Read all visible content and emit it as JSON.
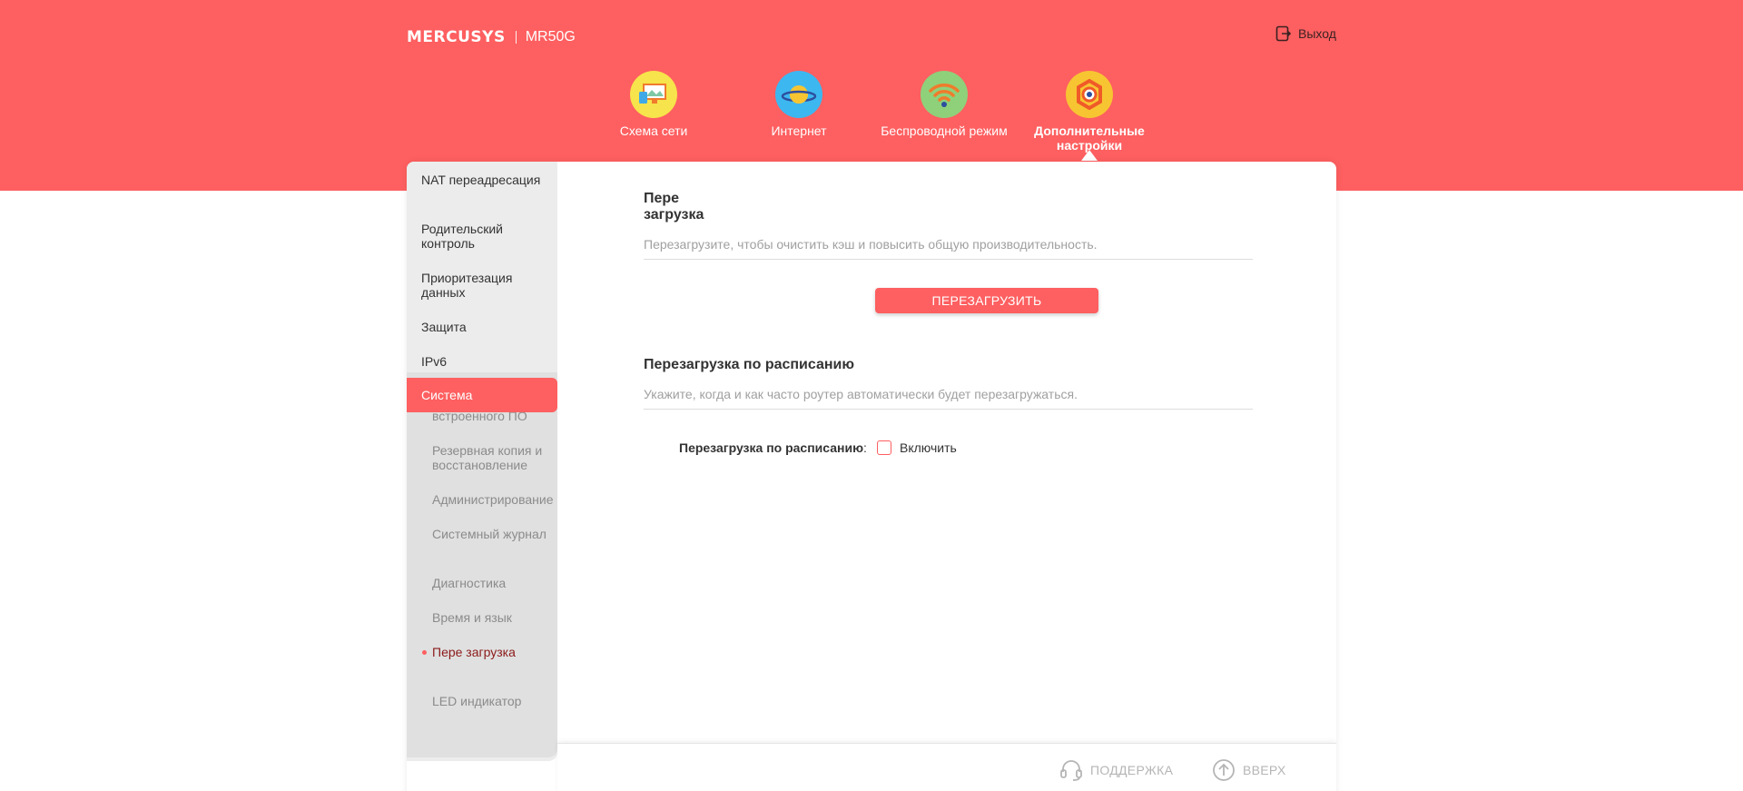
{
  "header": {
    "brand": "MERCUSYS",
    "model": "MR50G",
    "logout_label": "Выход"
  },
  "nav": {
    "items": [
      {
        "label": "Схема сети",
        "icon": "network-map-icon"
      },
      {
        "label": "Интернет",
        "icon": "internet-planet-icon"
      },
      {
        "label": "Беспроводной режим",
        "icon": "wifi-icon"
      },
      {
        "label": "Дополнительные настройки",
        "icon": "advanced-gear-icon"
      }
    ],
    "active_index": 3
  },
  "sidebar": {
    "items": [
      {
        "label": "NAT переадресация"
      },
      {
        "label": "Родительский контроль"
      },
      {
        "label": "Приоритезация данных"
      },
      {
        "label": "Защита"
      },
      {
        "label": "IPv6"
      },
      {
        "label": "Система"
      }
    ],
    "active_index": 5,
    "subitems": [
      {
        "label": "Обновление встроенного ПО"
      },
      {
        "label": "Резервная копия и восстановление"
      },
      {
        "label": "Администрирование"
      },
      {
        "label": "Системный журнал"
      },
      {
        "label": "Диагностика"
      },
      {
        "label": "Время и язык"
      },
      {
        "label": "Пере загрузка"
      },
      {
        "label": "LED индикатор"
      }
    ],
    "active_sub_index": 6
  },
  "reboot": {
    "title": "Пере загрузка",
    "description": "Перезагрузите, чтобы очистить кэш и повысить общую производительность.",
    "button_label": "ПЕРЕЗАГРУЗИТЬ"
  },
  "schedule": {
    "title": "Перезагрузка по расписанию",
    "description": "Укажите, когда и как часто роутер автоматически будет перезагружаться.",
    "field_label": "Перезагрузка по расписанию",
    "checkbox_label": "Включить",
    "enabled": false
  },
  "footer": {
    "support_label": "ПОДДЕРЖКА",
    "top_label": "ВВЕРХ"
  },
  "colors": {
    "accent": "#fe5f60",
    "sidebar_bg": "#ececec",
    "sub_bg": "#e0e0e0"
  }
}
